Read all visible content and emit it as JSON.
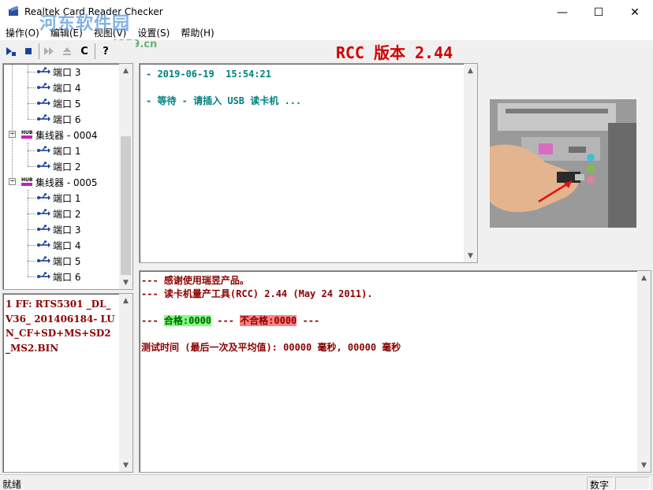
{
  "window": {
    "title": "Realtek Card Reader Checker",
    "minimize_glyph": "—",
    "maximize_glyph": "☐",
    "close_glyph": "✕"
  },
  "watermark": {
    "line1": "河东软件园",
    "line2": "www.pc0359.cn"
  },
  "menu": [
    {
      "label": "操作(O)"
    },
    {
      "label": "编辑(E)"
    },
    {
      "label": "视图(V)"
    },
    {
      "label": "设置(S)"
    },
    {
      "label": "帮助(H)"
    }
  ],
  "toolbar": {
    "buttons": [
      "run-icon",
      "stop-icon",
      "play-icon",
      "eject-icon",
      "clear-icon",
      "help-icon"
    ],
    "clear_label": "C",
    "help_label": "?"
  },
  "header": {
    "title": "RCC 版本 2.44"
  },
  "tree": {
    "rows": [
      {
        "kind": "port",
        "label": "端口 3"
      },
      {
        "kind": "port",
        "label": "端口 4"
      },
      {
        "kind": "port",
        "label": "端口 5"
      },
      {
        "kind": "port",
        "label": "端口 6"
      },
      {
        "kind": "hub",
        "label": "集线器 - 0004"
      },
      {
        "kind": "port",
        "label": "端口 1"
      },
      {
        "kind": "port",
        "label": "端口 2"
      },
      {
        "kind": "hub",
        "label": "集线器 - 0005"
      },
      {
        "kind": "port",
        "label": "端口 1"
      },
      {
        "kind": "port",
        "label": "端口 2"
      },
      {
        "kind": "port",
        "label": "端口 3"
      },
      {
        "kind": "port",
        "label": "端口 4"
      },
      {
        "kind": "port",
        "label": "端口 5"
      },
      {
        "kind": "port",
        "label": "端口 6"
      }
    ],
    "hub_icon_text": "HUB"
  },
  "info": {
    "text": "1 FF: RTS5301 _DL_V36_ 201406184- LUN_CF+SD+MS+SD2 _MS2.BIN"
  },
  "log": {
    "lines": [
      "- 2019-06-19  15:54:21",
      "",
      "- 等待 - 请插入 USB 读卡机 ..."
    ]
  },
  "result": {
    "line1": "--- 感谢使用瑞昱产品。",
    "line2": "--- 读卡机量产工具(RCC) 2.44 (May 24 2011).",
    "line3_prefix": "--- ",
    "pass": "合格:0000",
    "line3_mid": " --- ",
    "fail": "不合格:0000",
    "line3_suffix": " ---",
    "line4": "测试时间 (最后一次及平均值): 00000 毫秒, 00000 毫秒"
  },
  "status": {
    "main": "就绪",
    "num": "数字"
  },
  "colors": {
    "title_red": "#d00000",
    "log_teal": "#008080",
    "result_darkred": "#8b0000",
    "pass_green": "#80ff80",
    "fail_red": "#ff8080"
  }
}
